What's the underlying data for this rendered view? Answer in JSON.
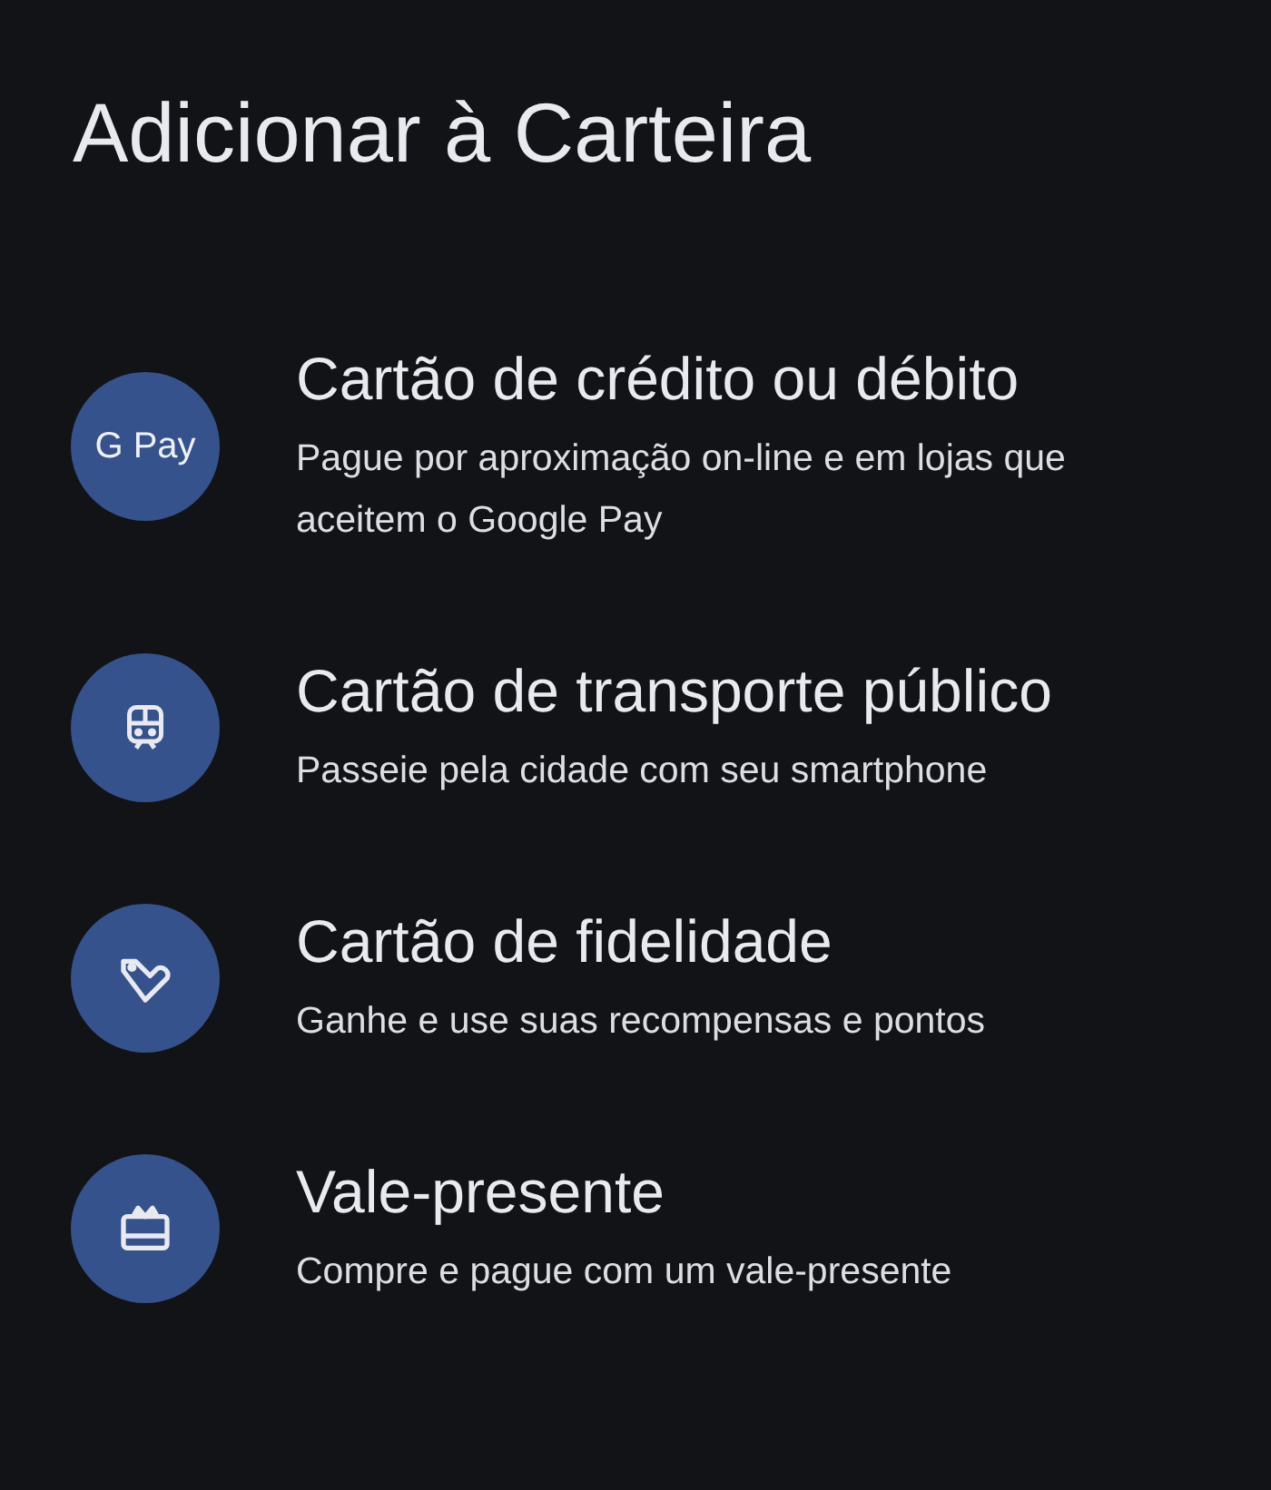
{
  "title": "Adicionar à Carteira",
  "options": [
    {
      "kind": "gpay",
      "icon_text": "G Pay",
      "title": "Cartão de crédito ou débito",
      "description": "Pague por aproximação on-line e em lojas que aceitem o Google Pay"
    },
    {
      "kind": "train",
      "title": "Cartão de transporte público",
      "description": "Passeie pela cidade com seu smartphone"
    },
    {
      "kind": "tag",
      "title": "Cartão de fidelidade",
      "description": "Ganhe e use suas recompensas e pontos"
    },
    {
      "kind": "gift",
      "title": "Vale-presente",
      "description": "Compre e pague com um vale-presente"
    }
  ]
}
